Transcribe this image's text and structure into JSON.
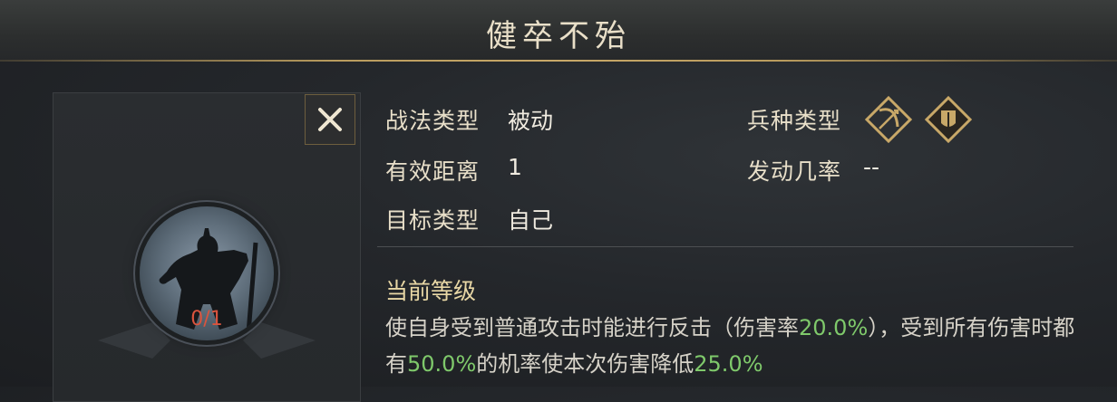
{
  "title": "健卒不殆",
  "stats": {
    "tactic_type_label": "战法类型",
    "tactic_type_value": "被动",
    "range_label": "有效距离",
    "range_value": "1",
    "target_label": "目标类型",
    "target_value": "自己",
    "troop_label": "兵种类型",
    "trigger_label": "发动几率",
    "trigger_value": "--"
  },
  "troop_icons": [
    "archer-bow-icon",
    "shield-infantry-icon"
  ],
  "level": {
    "count": "0/1",
    "section_title": "当前等级"
  },
  "description": {
    "p1": "使自身受到普通攻击时能进行反击（伤害率",
    "v1": "20.0%",
    "p2": "），受到所有伤害时都有",
    "v2": "50.0%",
    "p3": "的机率使本次伤害降低",
    "v3": "25.0%"
  },
  "colors": {
    "highlight": "#7fc96b",
    "gold": "#c8a868",
    "level_red": "#d9543e"
  }
}
